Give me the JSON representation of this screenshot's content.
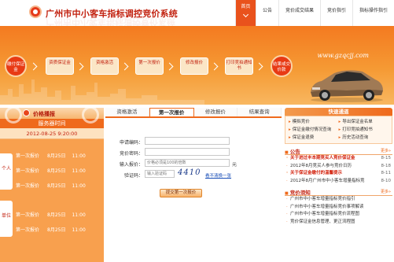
{
  "header": {
    "title": "广州市中小客车指标调控竞价系统",
    "nav": [
      {
        "label": "首页",
        "active": true
      },
      {
        "label": "公告",
        "active": false
      },
      {
        "label": "竞价成交结果",
        "active": false
      },
      {
        "label": "竞价指引",
        "active": false
      },
      {
        "label": "指标操作指引",
        "active": false
      }
    ]
  },
  "banner": {
    "domain": "www.gzqcjj.com",
    "steps": [
      "缴付保证金",
      "资质保证金",
      "资格激活",
      "第一次报价",
      "修改报价",
      "打印竞拍通知书",
      "结果或交价款"
    ]
  },
  "left": {
    "title": "价格播报",
    "server_label": "服务器时间",
    "server_time": "2012-08-25  9:20:00",
    "tabs": [
      "个人",
      "单位"
    ],
    "schedule": [
      {
        "label": "第一次报价",
        "date": "8月25日",
        "time": "11:00"
      },
      {
        "label": "第一次报价",
        "date": "8月25日",
        "time": "11:00"
      },
      {
        "label": "第一次报价",
        "date": "8月25日",
        "time": "11:00"
      },
      {
        "label": "第一次报价",
        "date": "8月25日",
        "time": "11:00"
      },
      {
        "label": "第一次报价",
        "date": "8月25日",
        "time": "11:00"
      }
    ]
  },
  "center": {
    "tabs": [
      "资格激活",
      "第一次报价",
      "修改报价",
      "结果查询"
    ],
    "active_tab": 1,
    "form": {
      "apply_label": "申请编码：",
      "password_label": "竞价密码：",
      "price_label": "输入报价：",
      "price_placeholder": "价格必须是100的倍数",
      "unit": "元",
      "captcha_label": "验证码：",
      "captcha_placeholder": "输入验证码",
      "captcha_code": "4410",
      "refresh_label": "看不清换一张",
      "submit_label": "提交第一次报价"
    }
  },
  "right": {
    "quick_title": "快速通道",
    "quick_links": [
      "模拟竞价",
      "保证金缴付情况查询",
      "保证金退费",
      "历史活动查询",
      "导出保证金名单",
      "打印竞拍通知书"
    ],
    "notice_title": "公告",
    "more_label": "更多»",
    "notices": [
      {
        "text": "关于进过丰本期竞买人竞价保证金",
        "date": "8-15",
        "red": true
      },
      {
        "text": "2012年8月竞买人参与竞价日历",
        "date": "8-18",
        "red": false
      },
      {
        "text": "关于保证金缴付的温馨提示",
        "date": "8-11",
        "red": true
      },
      {
        "text": "2012年8月广州市中小客车增量指标竞",
        "date": "8-10",
        "red": false
      }
    ],
    "guide_title": "竞价须知",
    "guides": [
      "广州市中小客车增量指标竞价指引",
      "广州市中小客车增量指标竞价事项解读",
      "广州市中小客车增量指标竞价流程图",
      "竞价保证金信息管理、更正流程图"
    ]
  }
}
